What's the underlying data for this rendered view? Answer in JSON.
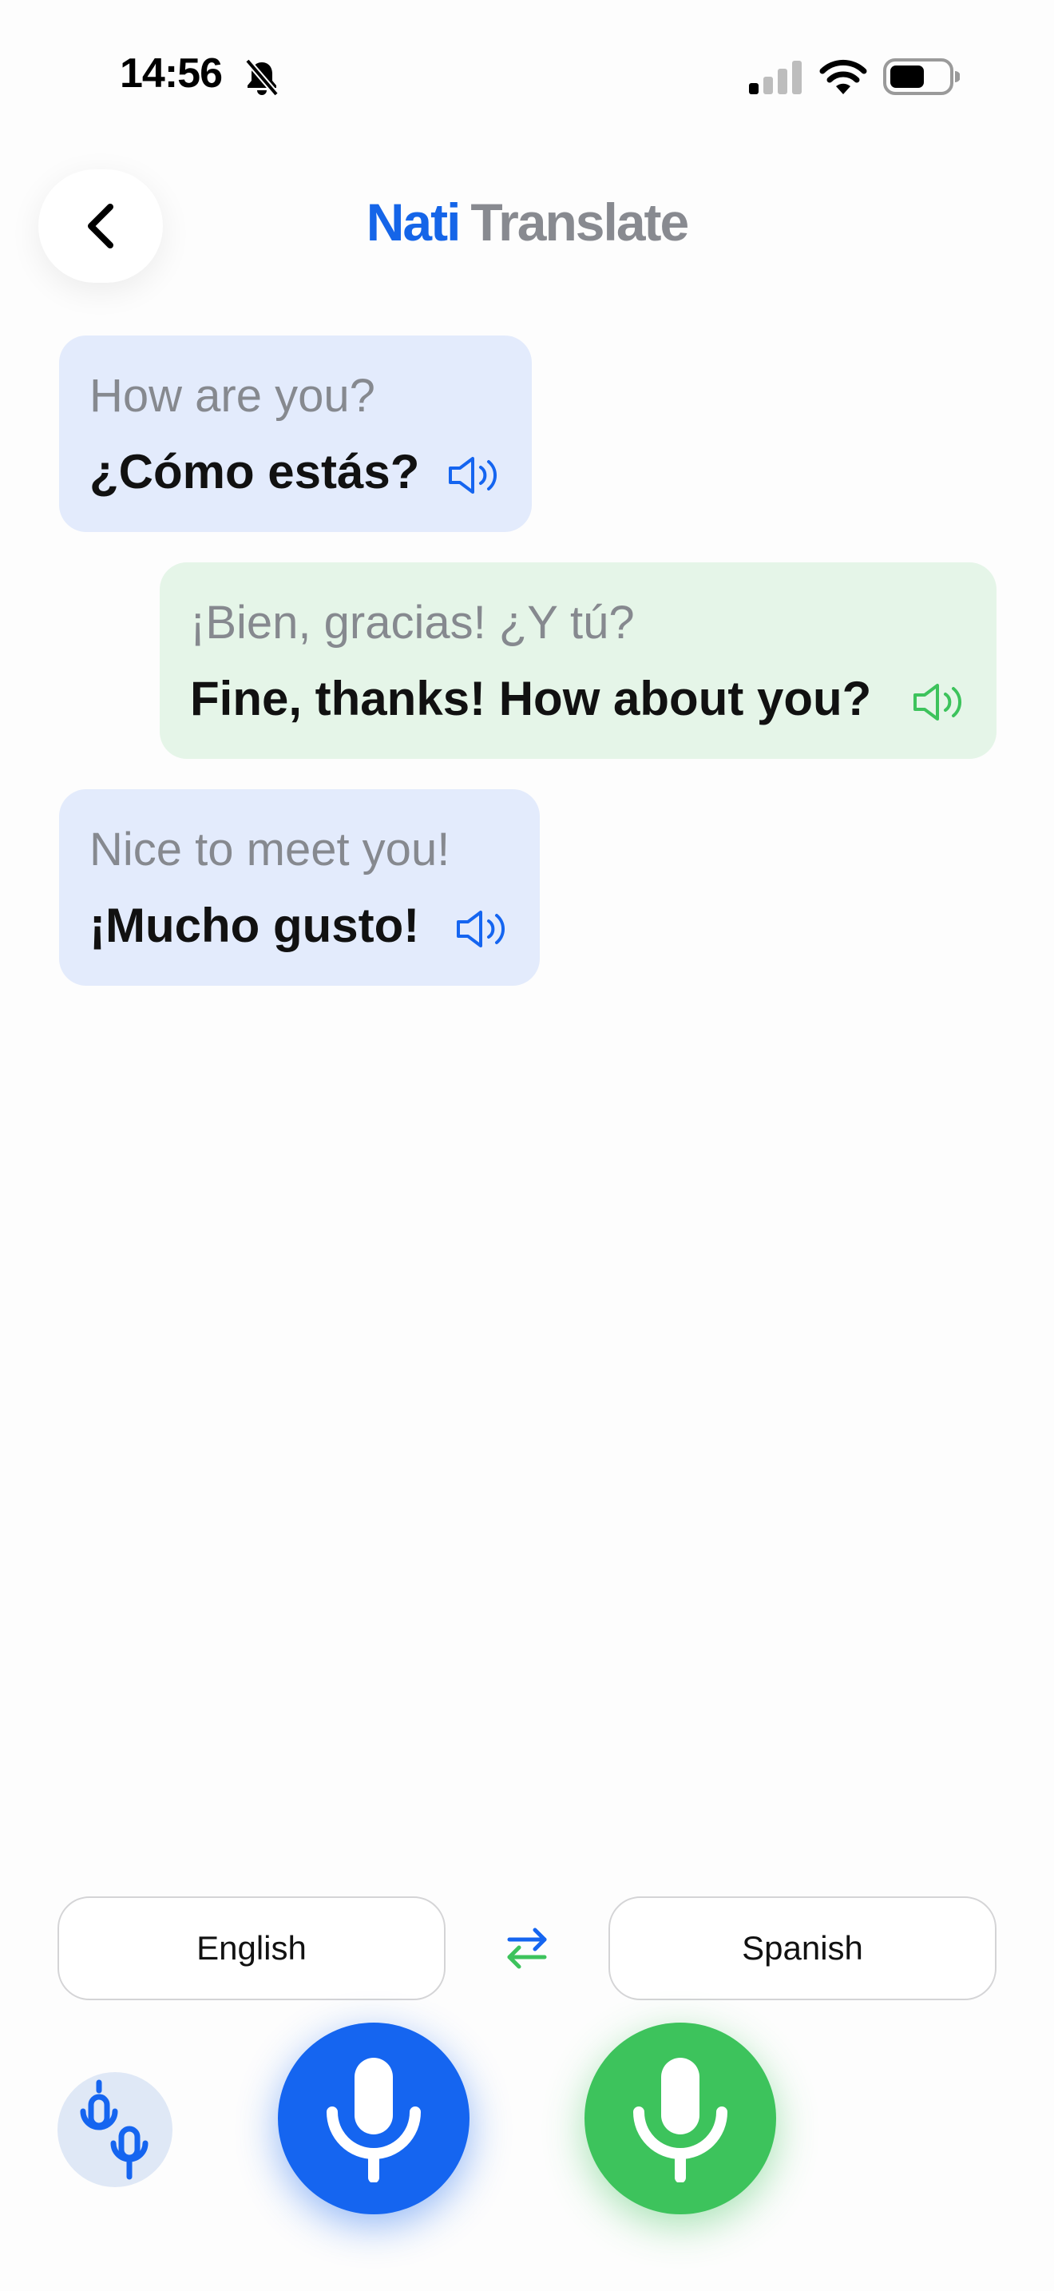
{
  "status_bar": {
    "time": "14:56",
    "icons": [
      "bell-slash-icon",
      "cellular-signal-icon",
      "wifi-icon",
      "battery-icon"
    ]
  },
  "header": {
    "brand": "Nati",
    "product": "Translate",
    "back_icon": "chevron-left-icon"
  },
  "conversation": [
    {
      "side": "left",
      "color": "blue",
      "source": "How are you?",
      "translation": "¿Cómo estás?"
    },
    {
      "side": "right",
      "color": "green",
      "source": "¡Bien, gracias! ¿Y tú?",
      "translation": "Fine, thanks! How about you?"
    },
    {
      "side": "left",
      "color": "blue",
      "source": "Nice to meet you!",
      "translation": "¡Mucho gusto!"
    }
  ],
  "languages": {
    "left": "English",
    "right": "Spanish",
    "swap_icon": "swap-arrows-icon"
  },
  "controls": {
    "mode_icon": "dual-microphone-icon",
    "mic_icon": "microphone-icon"
  },
  "colors": {
    "brand_blue": "#1565f0",
    "brand_green": "#3dc35c",
    "bubble_blue": "#e3ebfc",
    "bubble_green": "#e5f5e8",
    "muted_text": "#86898f"
  }
}
